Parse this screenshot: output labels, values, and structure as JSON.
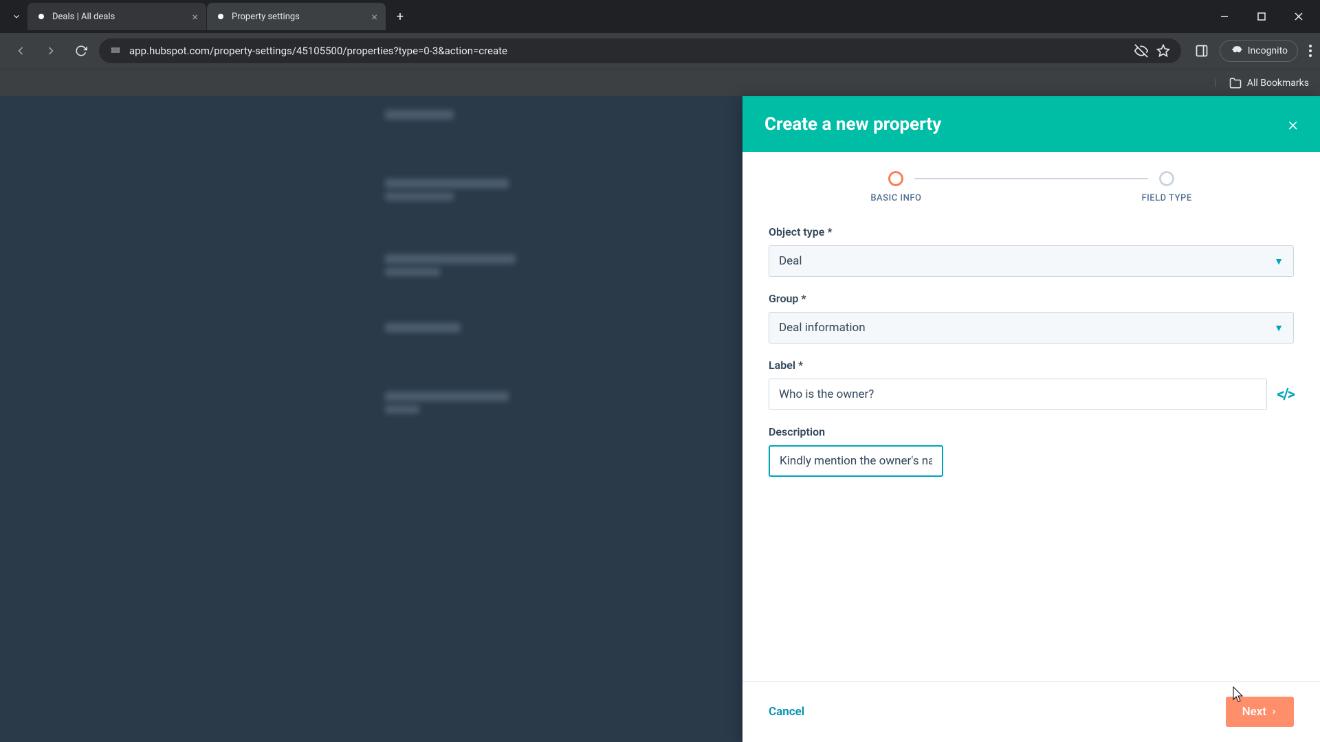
{
  "browser": {
    "tabs": [
      {
        "title": "Deals | All deals"
      },
      {
        "title": "Property settings"
      }
    ],
    "url": "app.hubspot.com/property-settings/45105500/properties?type=0-3&action=create",
    "incognito_label": "Incognito",
    "bookmarks_label": "All Bookmarks"
  },
  "panel": {
    "title": "Create a new property",
    "stepper": {
      "step1": "BASIC INFO",
      "step2": "FIELD TYPE"
    },
    "form": {
      "object_type_label": "Object type *",
      "object_type_value": "Deal",
      "group_label": "Group *",
      "group_value": "Deal information",
      "label_label": "Label *",
      "label_value": "Who is the owner?",
      "description_label": "Description",
      "description_value": "Kindly mention the owner's name"
    },
    "footer": {
      "cancel": "Cancel",
      "next": "Next"
    }
  }
}
